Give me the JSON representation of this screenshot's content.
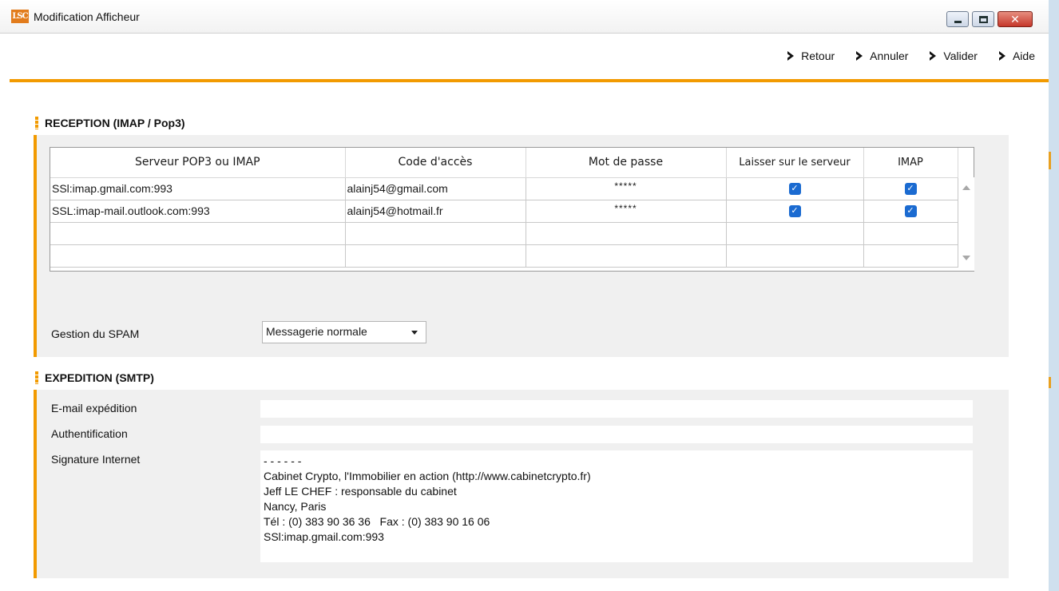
{
  "window": {
    "logo": "LSC",
    "title": "Modification Afficheur"
  },
  "toolbar": {
    "items": [
      "Retour",
      "Annuler",
      "Valider",
      "Aide"
    ]
  },
  "reception": {
    "title": "RECEPTION (IMAP / Pop3)",
    "columns": [
      "Serveur POP3 ou IMAP",
      "Code d'accès",
      "Mot de passe",
      "Laisser sur le serveur",
      "IMAP"
    ],
    "rows": [
      {
        "server": "SSl:imap.gmail.com:993",
        "login": "alainj54@gmail.com",
        "password": "*****",
        "leave_on_server": true,
        "imap": true
      },
      {
        "server": "SSL:imap-mail.outlook.com:993",
        "login": "alainj54@hotmail.fr",
        "password": "*****",
        "leave_on_server": true,
        "imap": true
      }
    ],
    "spam_label": "Gestion du SPAM",
    "spam_value": "Messagerie normale"
  },
  "expedition": {
    "title": "EXPEDITION (SMTP)",
    "email_label": "E-mail expédition",
    "email_value": "",
    "auth_label": "Authentification",
    "auth_value": "",
    "signature_label": "Signature Internet",
    "signature_lines": [
      "- - - - - -",
      "Cabinet Crypto, l'Immobilier en action (http://www.cabinetcrypto.fr)",
      "Jeff LE CHEF : responsable du cabinet",
      "Nancy, Paris",
      "Tél : (0) 383 90 36 36   Fax : (0) 383 90 16 06",
      "",
      "SSl:imap.gmail.com:993"
    ]
  },
  "colors": {
    "accent": "#f29a00",
    "checkbox": "#1b6bd1",
    "panel": "#f0f0f0"
  }
}
